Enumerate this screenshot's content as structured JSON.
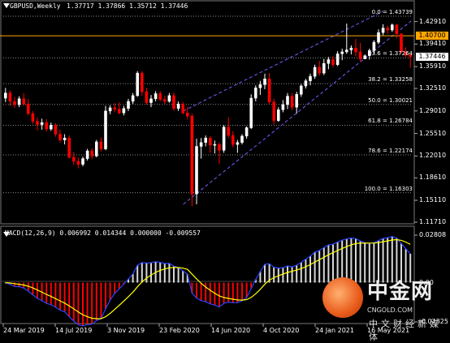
{
  "header": {
    "symbol": "GBPUSD,Weekly",
    "ohlc": "1.37717 1.37866 1.35712 1.37446"
  },
  "macd": {
    "label": "MACD(12,26,9) 0.006992 0.014344 0.000000 -0.009557"
  },
  "price_axis": [
    "1.42910",
    "1.39410",
    "1.35910",
    "1.32510",
    "1.29010",
    "1.25510",
    "1.22010",
    "1.18610",
    "1.15110",
    "1.11710"
  ],
  "macd_axis": [
    "0.02808",
    "0.00",
    "-0.02325"
  ],
  "price_tags": {
    "resistance": "1.40700",
    "current": "1.37446"
  },
  "fibonacci": [
    {
      "level": "0.0 = 1.43739",
      "price": 1.43739
    },
    {
      "level": "23.6 = 1.37264",
      "price": 1.37264
    },
    {
      "level": "38.2 = 1.33258",
      "price": 1.33258
    },
    {
      "level": "50.0 = 1.30021",
      "price": 1.30021
    },
    {
      "level": "61.8 = 1.26784",
      "price": 1.26784
    },
    {
      "level": "78.6 = 1.22174",
      "price": 1.22174
    },
    {
      "level": "100.0 = 1.16303",
      "price": 1.16303
    }
  ],
  "date_axis": [
    "24 Mar 2019",
    "14 Jul 2019",
    "3 Nov 2019",
    "23 Feb 2020",
    "14 Jun 2020",
    "4 Oct 2020",
    "24 Jan 2021",
    "16 May 2021"
  ],
  "watermark": {
    "title": "中金网",
    "site": "CNGOLD.COM",
    "tagline": "中文财经新媒体"
  },
  "colors": {
    "background": "#000000",
    "bull": "#ffffff",
    "bear": "#ff0000",
    "resistance_line": "#ffa500",
    "channel": "#7b5cff",
    "macd_line": "#2a46ff",
    "signal_line": "#ffff00",
    "fib": "#8a8a8a"
  },
  "chart_data": {
    "type": "candlestick",
    "symbol": "GBPUSD",
    "timeframe": "Weekly",
    "last": {
      "open": 1.37717,
      "high": 1.37866,
      "low": 1.35712,
      "close": 1.37446
    },
    "y_range": [
      1.1171,
      1.445
    ],
    "horizontal_level": 1.407,
    "channel": {
      "upper": [
        {
          "x": "2020-03-15",
          "y": 1.29
        },
        {
          "x": "2021-04-15",
          "y": 1.445
        }
      ],
      "lower": [
        {
          "x": "2020-03-15",
          "y": 1.145
        },
        {
          "x": "2021-06-10",
          "y": 1.43
        }
      ]
    },
    "candles": [
      [
        1.31,
        1.326,
        1.304,
        1.318
      ],
      [
        1.318,
        1.322,
        1.298,
        1.305
      ],
      [
        1.305,
        1.312,
        1.295,
        1.3
      ],
      [
        1.3,
        1.313,
        1.296,
        1.309
      ],
      [
        1.309,
        1.318,
        1.298,
        1.301
      ],
      [
        1.301,
        1.309,
        1.283,
        1.286
      ],
      [
        1.286,
        1.29,
        1.27,
        1.274
      ],
      [
        1.274,
        1.28,
        1.26,
        1.269
      ],
      [
        1.269,
        1.278,
        1.261,
        1.272
      ],
      [
        1.272,
        1.277,
        1.258,
        1.262
      ],
      [
        1.262,
        1.272,
        1.259,
        1.268
      ],
      [
        1.268,
        1.271,
        1.25,
        1.254
      ],
      [
        1.254,
        1.261,
        1.241,
        1.245
      ],
      [
        1.245,
        1.254,
        1.238,
        1.248
      ],
      [
        1.248,
        1.252,
        1.216,
        1.218
      ],
      [
        1.218,
        1.226,
        1.206,
        1.212
      ],
      [
        1.212,
        1.218,
        1.201,
        1.207
      ],
      [
        1.207,
        1.219,
        1.204,
        1.216
      ],
      [
        1.216,
        1.231,
        1.213,
        1.228
      ],
      [
        1.228,
        1.232,
        1.215,
        1.22
      ],
      [
        1.22,
        1.245,
        1.218,
        1.242
      ],
      [
        1.242,
        1.249,
        1.227,
        1.231
      ],
      [
        1.231,
        1.298,
        1.229,
        1.29
      ],
      [
        1.29,
        1.299,
        1.285,
        1.295
      ],
      [
        1.295,
        1.302,
        1.288,
        1.293
      ],
      [
        1.293,
        1.304,
        1.285,
        1.287
      ],
      [
        1.287,
        1.298,
        1.283,
        1.294
      ],
      [
        1.294,
        1.309,
        1.29,
        1.305
      ],
      [
        1.305,
        1.318,
        1.301,
        1.314
      ],
      [
        1.314,
        1.352,
        1.312,
        1.349
      ],
      [
        1.349,
        1.352,
        1.314,
        1.32
      ],
      [
        1.32,
        1.326,
        1.3,
        1.303
      ],
      [
        1.303,
        1.315,
        1.296,
        1.309
      ],
      [
        1.309,
        1.321,
        1.305,
        1.317
      ],
      [
        1.317,
        1.321,
        1.305,
        1.308
      ],
      [
        1.308,
        1.314,
        1.3,
        1.305
      ],
      [
        1.305,
        1.318,
        1.303,
        1.314
      ],
      [
        1.314,
        1.319,
        1.29,
        1.294
      ],
      [
        1.294,
        1.305,
        1.29,
        1.301
      ],
      [
        1.301,
        1.304,
        1.285,
        1.287
      ],
      [
        1.287,
        1.296,
        1.277,
        1.282
      ],
      [
        1.282,
        1.286,
        1.142,
        1.161
      ],
      [
        1.161,
        1.247,
        1.145,
        1.235
      ],
      [
        1.235,
        1.248,
        1.216,
        1.241
      ],
      [
        1.241,
        1.252,
        1.235,
        1.248
      ],
      [
        1.248,
        1.251,
        1.225,
        1.237
      ],
      [
        1.237,
        1.244,
        1.224,
        1.238
      ],
      [
        1.238,
        1.241,
        1.208,
        1.229
      ],
      [
        1.229,
        1.268,
        1.225,
        1.265
      ],
      [
        1.265,
        1.28,
        1.248,
        1.252
      ],
      [
        1.252,
        1.259,
        1.234,
        1.238
      ],
      [
        1.238,
        1.245,
        1.225,
        1.241
      ],
      [
        1.241,
        1.254,
        1.238,
        1.251
      ],
      [
        1.251,
        1.266,
        1.247,
        1.264
      ],
      [
        1.264,
        1.316,
        1.262,
        1.31
      ],
      [
        1.31,
        1.33,
        1.305,
        1.326
      ],
      [
        1.326,
        1.337,
        1.315,
        1.331
      ],
      [
        1.331,
        1.348,
        1.324,
        1.34
      ],
      [
        1.34,
        1.349,
        1.3,
        1.304
      ],
      [
        1.304,
        1.309,
        1.269,
        1.275
      ],
      [
        1.275,
        1.296,
        1.273,
        1.292
      ],
      [
        1.292,
        1.307,
        1.288,
        1.3
      ],
      [
        1.3,
        1.318,
        1.293,
        1.313
      ],
      [
        1.313,
        1.318,
        1.291,
        1.296
      ],
      [
        1.296,
        1.32,
        1.286,
        1.316
      ],
      [
        1.316,
        1.332,
        1.312,
        1.329
      ],
      [
        1.329,
        1.34,
        1.325,
        1.337
      ],
      [
        1.337,
        1.348,
        1.33,
        1.344
      ],
      [
        1.344,
        1.362,
        1.34,
        1.358
      ],
      [
        1.358,
        1.368,
        1.345,
        1.349
      ],
      [
        1.349,
        1.371,
        1.346,
        1.364
      ],
      [
        1.364,
        1.374,
        1.355,
        1.37
      ],
      [
        1.37,
        1.376,
        1.358,
        1.362
      ],
      [
        1.362,
        1.383,
        1.36,
        1.379
      ],
      [
        1.379,
        1.387,
        1.369,
        1.382
      ],
      [
        1.382,
        1.426,
        1.379,
        1.385
      ],
      [
        1.385,
        1.392,
        1.378,
        1.388
      ],
      [
        1.388,
        1.402,
        1.375,
        1.382
      ],
      [
        1.382,
        1.396,
        1.367,
        1.371
      ],
      [
        1.371,
        1.378,
        1.371,
        1.376
      ],
      [
        1.376,
        1.387,
        1.37,
        1.384
      ],
      [
        1.384,
        1.4,
        1.379,
        1.397
      ],
      [
        1.397,
        1.417,
        1.394,
        1.412
      ],
      [
        1.412,
        1.425,
        1.408,
        1.419
      ],
      [
        1.419,
        1.423,
        1.41,
        1.416
      ],
      [
        1.416,
        1.426,
        1.413,
        1.424
      ],
      [
        1.424,
        1.425,
        1.403,
        1.41
      ],
      [
        1.41,
        1.411,
        1.379,
        1.382
      ],
      [
        1.382,
        1.389,
        1.374,
        1.377
      ],
      [
        1.37717,
        1.37866,
        1.35712,
        1.37446
      ]
    ],
    "macd_series": {
      "name": "MACD(12,26,9)",
      "values": {
        "main": 0.006992,
        "signal": 0.014344,
        "extra_1": 0.0,
        "extra_2": -0.009557
      },
      "ylim": [
        -0.02325,
        0.02808
      ]
    }
  }
}
